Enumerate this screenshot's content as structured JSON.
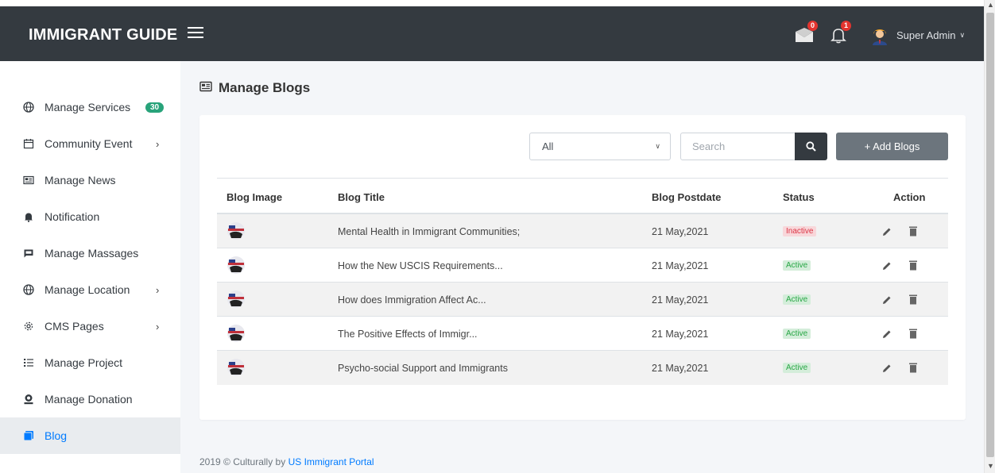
{
  "brand": "IMMIGRANT GUIDE",
  "header": {
    "mail_count": "0",
    "notif_count": "1",
    "user_name": "Super Admin"
  },
  "sidebar": {
    "items": [
      {
        "label": "Manage Services",
        "icon": "globe-icon",
        "count": "30"
      },
      {
        "label": "Community Event",
        "icon": "calendar-icon",
        "has_children": true
      },
      {
        "label": "Manage News",
        "icon": "newspaper-icon"
      },
      {
        "label": "Notification",
        "icon": "bell-icon"
      },
      {
        "label": "Manage Massages",
        "icon": "message-icon"
      },
      {
        "label": "Manage Location",
        "icon": "globe-icon",
        "has_children": true
      },
      {
        "label": "CMS Pages",
        "icon": "gear-icon",
        "has_children": true
      },
      {
        "label": "Manage Project",
        "icon": "list-icon"
      },
      {
        "label": "Manage Donation",
        "icon": "donation-icon"
      },
      {
        "label": "Blog",
        "icon": "blog-icon",
        "active": true
      }
    ]
  },
  "page": {
    "title": "Manage Blogs"
  },
  "toolbar": {
    "filter_value": "All",
    "search_placeholder": "Search",
    "add_label": "+ Add Blogs"
  },
  "table": {
    "headers": [
      "Blog Image",
      "Blog Title",
      "Blog Postdate",
      "Status",
      "Action"
    ],
    "rows": [
      {
        "title": "Mental Health in Immigrant Communities;",
        "date": "21 May,2021",
        "status": "Inactive"
      },
      {
        "title": "How the New USCIS Requirements...",
        "date": "21 May,2021",
        "status": "Active"
      },
      {
        "title": "How does Immigration Affect Ac...",
        "date": "21 May,2021",
        "status": "Active"
      },
      {
        "title": "The Positive Effects of Immigr...",
        "date": "21 May,2021",
        "status": "Active"
      },
      {
        "title": "Psycho-social Support and Immigrants",
        "date": "21 May,2021",
        "status": "Active"
      }
    ]
  },
  "footer": {
    "prefix": "2019 © Culturally by ",
    "link": "US Immigrant Portal"
  },
  "colors": {
    "topbar": "#343a40",
    "accent": "#007bff",
    "badge_green": "#28a37a",
    "badge_red": "#e3342f",
    "active_status": "#28a745",
    "inactive_status": "#dc3545"
  }
}
